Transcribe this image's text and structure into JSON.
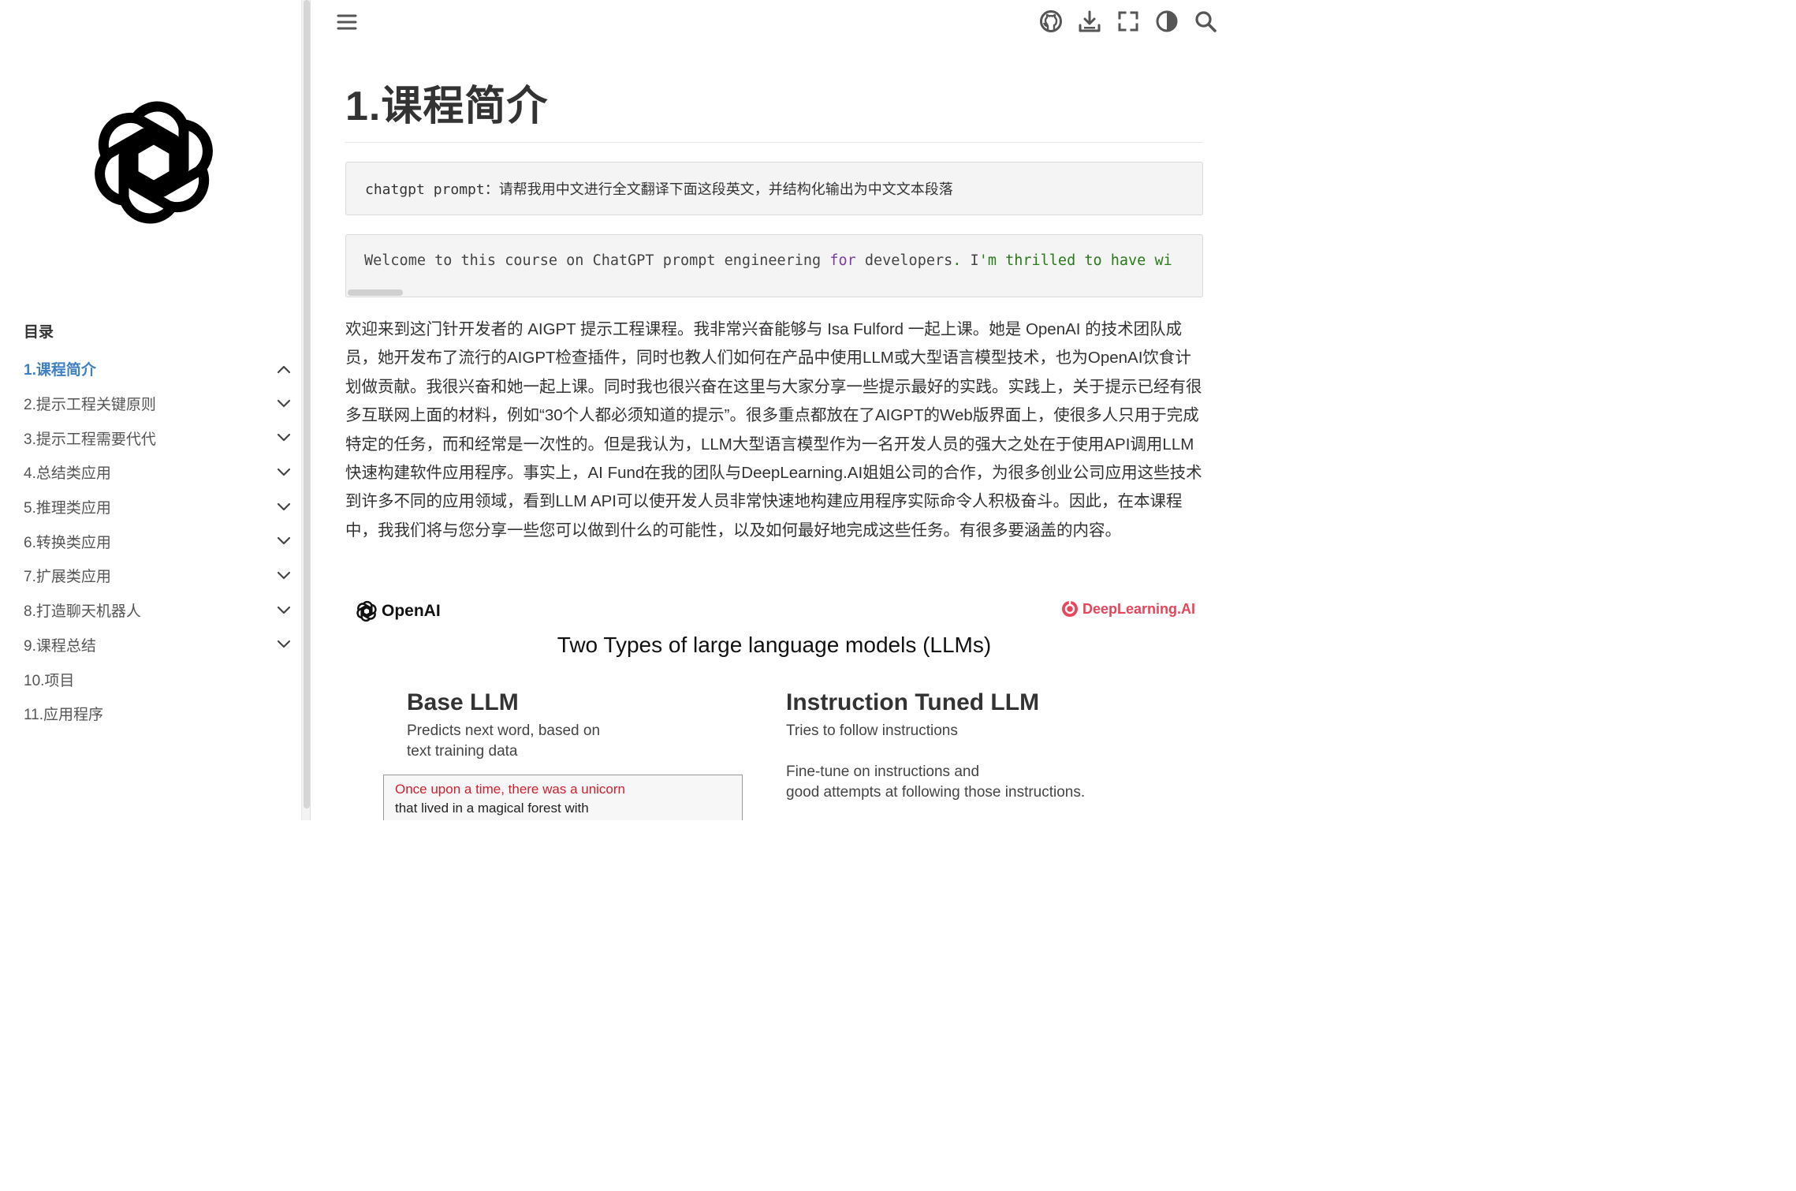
{
  "sidebar": {
    "toc_heading": "目录",
    "items": [
      {
        "label": "1.课程简介",
        "active": true,
        "chevron": "chevron-up-icon"
      },
      {
        "label": "2.提示工程关键原则",
        "active": false,
        "chevron": "chevron-down-icon"
      },
      {
        "label": "3.提示工程需要代代",
        "active": false,
        "chevron": "chevron-down-icon"
      },
      {
        "label": "4.总结类应用",
        "active": false,
        "chevron": "chevron-down-icon"
      },
      {
        "label": "5.推理类应用",
        "active": false,
        "chevron": "chevron-down-icon"
      },
      {
        "label": "6.转换类应用",
        "active": false,
        "chevron": "chevron-down-icon"
      },
      {
        "label": "7.扩展类应用",
        "active": false,
        "chevron": "chevron-down-icon"
      },
      {
        "label": "8.打造聊天机器人",
        "active": false,
        "chevron": "chevron-down-icon"
      },
      {
        "label": "9.课程总结",
        "active": false,
        "chevron": "chevron-down-icon"
      },
      {
        "label": "10.项目",
        "active": false,
        "chevron": ""
      },
      {
        "label": "11.应用程序",
        "active": false,
        "chevron": ""
      }
    ]
  },
  "toolbar": {
    "icons": [
      "menu-icon",
      "github-icon",
      "download-icon",
      "fullscreen-icon",
      "theme-toggle-icon",
      "search-icon"
    ]
  },
  "main": {
    "title": "1.课程简介",
    "code_prompt": "chatgpt prompt：请帮我用中文进行全文翻译下面这段英文，并结构化输出为中文文本段落",
    "code_line": {
      "part1": "Welcome to this course on ChatGPT prompt engineering ",
      "kw": "for",
      "part2": " developers",
      "dot": ".",
      "part3": " I",
      "str": "'m thrilled to have wi"
    },
    "paragraph": "欢迎来到这门针开发者的 AIGPT 提示工程课程。我非常兴奋能够与 Isa Fulford 一起上课。她是 OpenAI 的技术团队成员，她开发布了流行的AIGPT检查插件，同时也教人们如何在产品中使用LLM或大型语言模型技术，也为OpenAI饮食计划做贡献。我很兴奋和她一起上课。同时我也很兴奋在这里与大家分享一些提示最好的实践。实践上，关于提示已经有很多互联网上面的材料，例如“30个人都必须知道的提示”。很多重点都放在了AIGPT的Web版界面上，使很多人只用于完成特定的任务，而和经常是一次性的。但是我认为，LLM大型语言模型作为一名开发人员的强大之处在于使用API调用LLM快速构建软件应用程序。事实上，AI Fund在我的团队与DeepLearning.AI姐姐公司的合作，为很多创业公司应用这些技术到许多不同的应用领域，看到LLM API可以使开发人员非常快速地构建应用程序实际命令人积极奋斗。因此，在本课程中，我我们将与您分享一些您可以做到什么的可能性，以及如何最好地完成这些任务。有很多要涵盖的内容。"
  },
  "slide": {
    "openai_label": "OpenAI",
    "dl_label": "DeepLearning.AI",
    "title": "Two Types of large language models (LLMs)",
    "base_title": "Base LLM",
    "base_desc_1": "Predicts next word, based on",
    "base_desc_2": "text training data",
    "example_red": "Once upon a time, there was a unicorn",
    "example_black": "that lived in a magical forest with",
    "instr_title": "Instruction Tuned LLM",
    "instr_desc_1": "Tries to follow instructions",
    "instr_desc_2": "Fine-tune on instructions and",
    "instr_desc_3": "good attempts at following those instructions."
  },
  "colors": {
    "accent": "#3f80c5",
    "keyword": "#7a3e9d",
    "string": "#2a7a1a",
    "dl_brand": "#e8445a",
    "example_red": "#d0202e"
  }
}
